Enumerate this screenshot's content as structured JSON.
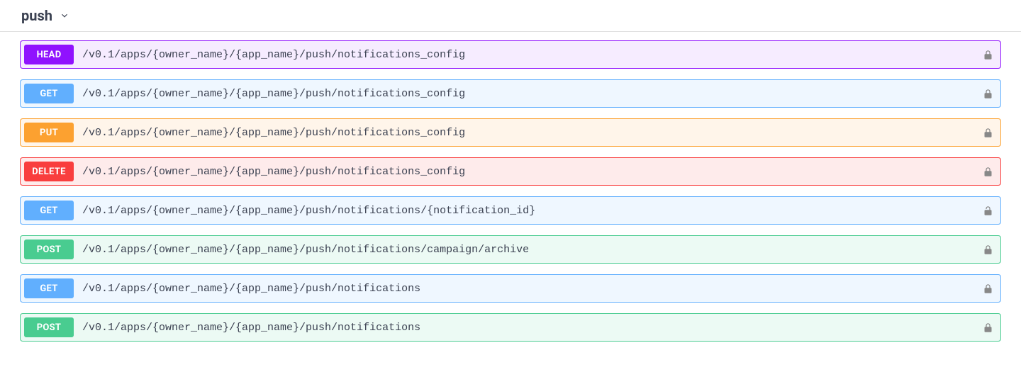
{
  "section": {
    "title": "push"
  },
  "operations": [
    {
      "method": "HEAD",
      "path": "/v0.1/apps/{owner_name}/{app_name}/push/notifications_config"
    },
    {
      "method": "GET",
      "path": "/v0.1/apps/{owner_name}/{app_name}/push/notifications_config"
    },
    {
      "method": "PUT",
      "path": "/v0.1/apps/{owner_name}/{app_name}/push/notifications_config"
    },
    {
      "method": "DELETE",
      "path": "/v0.1/apps/{owner_name}/{app_name}/push/notifications_config"
    },
    {
      "method": "GET",
      "path": "/v0.1/apps/{owner_name}/{app_name}/push/notifications/{notification_id}"
    },
    {
      "method": "POST",
      "path": "/v0.1/apps/{owner_name}/{app_name}/push/notifications/campaign/archive"
    },
    {
      "method": "GET",
      "path": "/v0.1/apps/{owner_name}/{app_name}/push/notifications"
    },
    {
      "method": "POST",
      "path": "/v0.1/apps/{owner_name}/{app_name}/push/notifications"
    }
  ]
}
